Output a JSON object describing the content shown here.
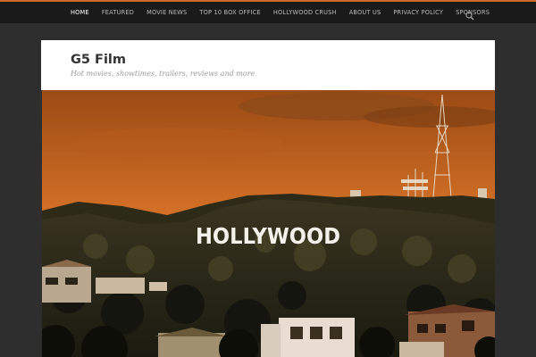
{
  "site": {
    "title": "G5 Film",
    "tagline": "Hot movies, showtimes, trailers, reviews and more"
  },
  "nav": {
    "items": [
      {
        "label": "HOME",
        "active": true
      },
      {
        "label": "FEATURED"
      },
      {
        "label": "MOVIE NEWS"
      },
      {
        "label": "TOP 10 BOX OFFICE"
      },
      {
        "label": "HOLLYWOOD CRUSH"
      },
      {
        "label": "ABOUT US"
      },
      {
        "label": "PRIVACY POLICY"
      },
      {
        "label": "SPONSORS"
      }
    ],
    "search_icon": "search-icon"
  },
  "hero": {
    "sign_text": "HOLLYWOOD"
  },
  "colors": {
    "accent": "#cc6a2a",
    "topbar": "#1a1a1a",
    "background": "#2e2e2e",
    "sky": "#c8641f"
  }
}
